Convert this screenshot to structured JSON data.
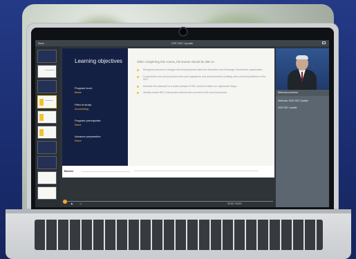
{
  "app": {
    "window_title": "CPE SEC Update",
    "back_label": "Back"
  },
  "slide": {
    "heading": "Learning objectives",
    "program_level_label": "Program level:",
    "program_level_value": "Basic",
    "field_of_study_label": "Field of study:",
    "field_of_study_value": "Accounting",
    "prerequisite_label": "Program prerequisite:",
    "prerequisite_value": "None",
    "advance_prep_label": "Advance preparation:",
    "advance_prep_value": "None",
    "intro": "After completing this course, the learner should be able to:",
    "objectives": [
      "Recognize personnel changes and developments within the Securities and Exchange Commission organization.",
      "Comprehend new and proposed rules and regulations, and amendments to existing rules and interpretations of the SEC.",
      "Describe the rationale for a select sample of SEC comment letters on registrants' filings.",
      "Identify certain SEC enforcement actions that occurred in the most recent year."
    ],
    "footer_brand": "Becker"
  },
  "sidebar": {
    "presenter": "Webcast presenter",
    "course": "Webcast: 2020 SEC Update",
    "sub": "2020 SEC update"
  },
  "controls": {
    "time_display": "00:00 / 54:50"
  },
  "colors": {
    "navy": "#142043",
    "accent": "#f1c232"
  }
}
